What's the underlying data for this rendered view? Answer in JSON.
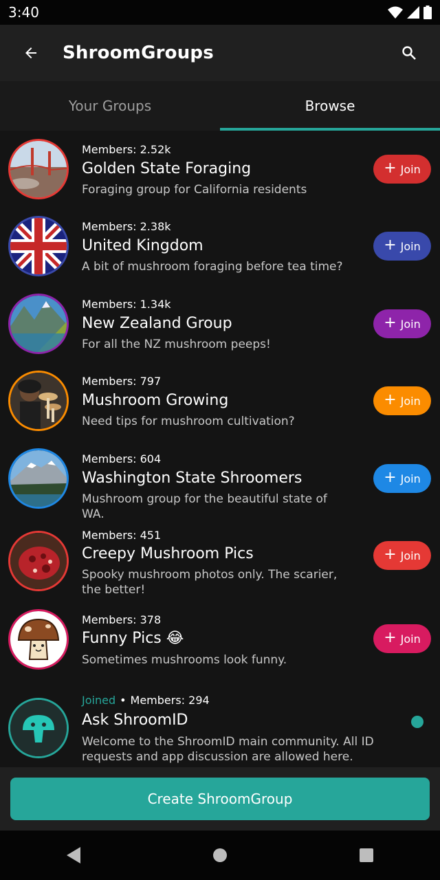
{
  "status_bar": {
    "time": "3:40"
  },
  "app_bar": {
    "title": "ShroomGroups"
  },
  "tabs": [
    {
      "label": "Your Groups",
      "active": false
    },
    {
      "label": "Browse",
      "active": true
    }
  ],
  "groups": [
    {
      "members": "Members: 2.52k",
      "name": "Golden State Foraging",
      "description": "Foraging group for California residents",
      "join_label": "Join",
      "color": "#d32f2f"
    },
    {
      "members": "Members: 2.38k",
      "name": "United Kingdom",
      "description": "A bit of mushroom foraging before tea time?",
      "join_label": "Join",
      "color": "#3949ab"
    },
    {
      "members": "Members: 1.34k",
      "name": "New Zealand Group",
      "description": "For all the NZ mushroom peeps!",
      "join_label": "Join",
      "color": "#8e24aa"
    },
    {
      "members": "Members: 797",
      "name": "Mushroom Growing",
      "description": "Need tips for mushroom cultivation?",
      "join_label": "Join",
      "color": "#fb8c00"
    },
    {
      "members": "Members: 604",
      "name": "Washington State Shroomers",
      "description": "Mushroom group for the beautiful state of WA.",
      "join_label": "Join",
      "color": "#1e88e5"
    },
    {
      "members": "Members: 451",
      "name": "Creepy Mushroom Pics",
      "description": "Spooky mushroom photos only. The scarier, the better!",
      "join_label": "Join",
      "color": "#e53935"
    },
    {
      "members": "Members: 378",
      "name": "Funny Pics 😂",
      "description": "Sometimes mushrooms look funny.",
      "join_label": "Join",
      "color": "#d81b60"
    },
    {
      "joined_label": "Joined",
      "members": "Members: 294",
      "name": "Ask ShroomID",
      "description": "Welcome to the ShroomID main community. All ID requests and app discussion are allowed here.",
      "color": "#26a69a"
    }
  ],
  "create_button": {
    "label": "Create ShroomGroup"
  },
  "accent_color": "#26a69a"
}
